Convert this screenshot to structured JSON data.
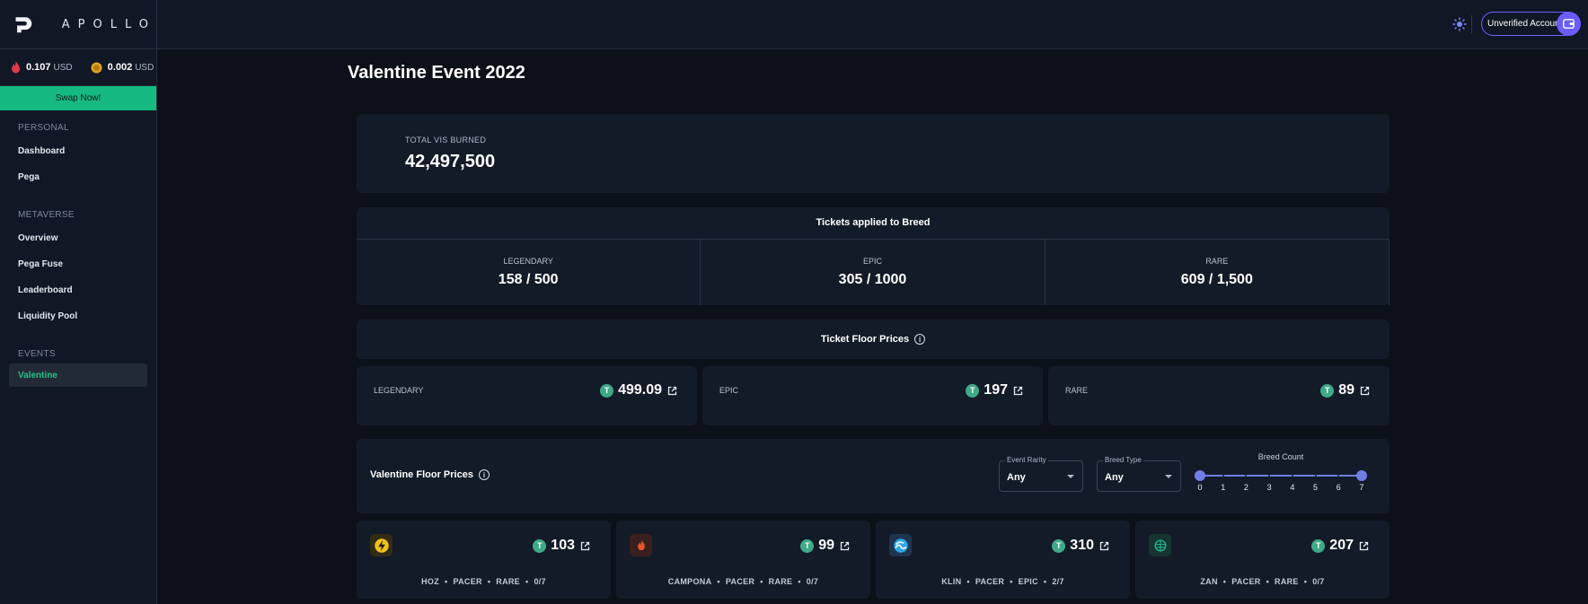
{
  "app": {
    "name": "APOLLO"
  },
  "sidebar": {
    "prices": [
      {
        "icon": "vis-flame-icon",
        "value": "0.107",
        "currency": "USD"
      },
      {
        "icon": "pgx-coin-icon",
        "value": "0.002",
        "currency": "USD"
      }
    ],
    "swap_label": "Swap Now!",
    "sections": [
      {
        "title": "PERSONAL",
        "items": [
          "Dashboard",
          "Pega"
        ]
      },
      {
        "title": "METAVERSE",
        "items": [
          "Overview",
          "Pega Fuse",
          "Leaderboard",
          "Liquidity Pool"
        ]
      },
      {
        "title": "EVENTS",
        "items": [
          "Valentine"
        ]
      }
    ],
    "active_item": "Valentine"
  },
  "header": {
    "account_label": "Unverified Account"
  },
  "main": {
    "title": "Valentine Event 2022",
    "total": {
      "label": "TOTAL VIS BURNED",
      "value": "42,497,500"
    },
    "tickets": {
      "title": "Tickets applied to Breed",
      "cells": [
        {
          "label": "LEGENDARY",
          "value": "158 / 500"
        },
        {
          "label": "EPIC",
          "value": "305 / 1000"
        },
        {
          "label": "RARE",
          "value": "609 / 1,500"
        }
      ]
    },
    "floor": {
      "title": "Ticket Floor Prices",
      "cards": [
        {
          "label": "LEGENDARY",
          "value": "499.09"
        },
        {
          "label": "EPIC",
          "value": "197"
        },
        {
          "label": "RARE",
          "value": "89"
        }
      ]
    },
    "valentine": {
      "title": "Valentine Floor Prices",
      "filters": {
        "event_rarity": {
          "label": "Event Rarity",
          "value": "Any"
        },
        "breed_type": {
          "label": "Breed Type",
          "value": "Any"
        },
        "breed_count": {
          "label": "Breed Count",
          "marks": [
            "0",
            "1",
            "2",
            "3",
            "4",
            "5",
            "6",
            "7"
          ],
          "range": [
            0,
            7
          ]
        }
      },
      "cards": [
        {
          "icon": "lightning-icon",
          "icon_color": "#f2c21b",
          "value": "103",
          "name": "HOZ",
          "type": "PACER",
          "rarity": "RARE",
          "breeds": "0/7"
        },
        {
          "icon": "fire-icon",
          "icon_color": "#e8542d",
          "value": "99",
          "name": "CAMPONA",
          "type": "PACER",
          "rarity": "RARE",
          "breeds": "0/7"
        },
        {
          "icon": "water-icon",
          "icon_color": "#2ea7e8",
          "value": "310",
          "name": "KLIN",
          "type": "PACER",
          "rarity": "EPIC",
          "breeds": "2/7"
        },
        {
          "icon": "wind-icon",
          "icon_color": "#22b38f",
          "value": "207",
          "name": "ZAN",
          "type": "PACER",
          "rarity": "RARE",
          "breeds": "0/7"
        }
      ]
    }
  },
  "colors": {
    "accent": "#16b982",
    "purple": "#6a5cff",
    "tether": "#3eaa88"
  }
}
